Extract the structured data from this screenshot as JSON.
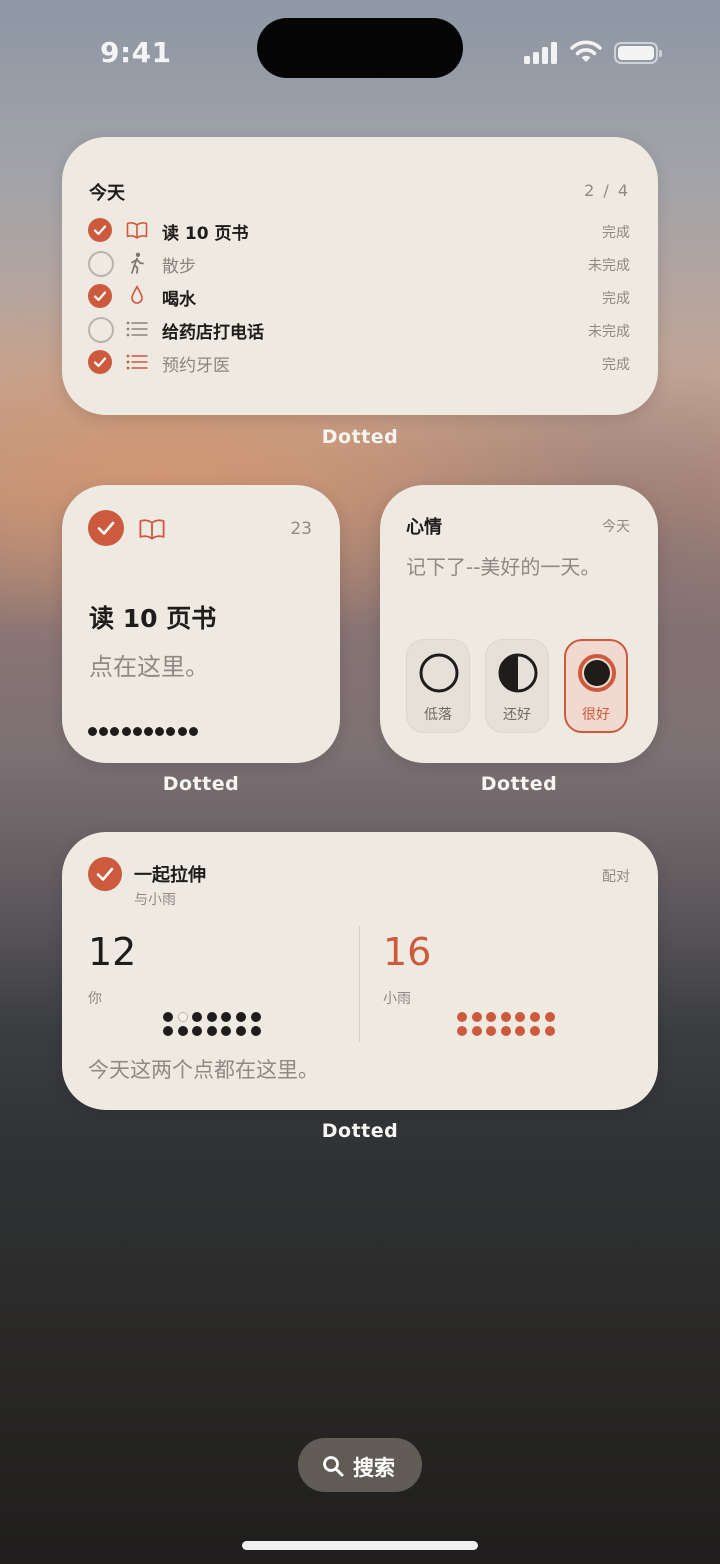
{
  "status_bar": {
    "time": "9:41"
  },
  "tasks_widget": {
    "title": "今天",
    "count": "2 / 4",
    "items": [
      {
        "label": "读 10 页书",
        "status": "完成",
        "done": true,
        "icon": "book-icon"
      },
      {
        "label": "散步",
        "status": "未完成",
        "done": false,
        "icon": "walk-icon"
      },
      {
        "label": "喝水",
        "status": "完成",
        "done": true,
        "icon": "drop-icon"
      },
      {
        "label": "给药店打电话",
        "status": "未完成",
        "done": false,
        "icon": "list-icon"
      },
      {
        "label": "预约牙医",
        "status": "完成",
        "done": true,
        "icon": "list-icon"
      }
    ],
    "caption": "Dotted"
  },
  "reading_widget": {
    "count": "23",
    "title": "读 10 页书",
    "hint": "点在这里。",
    "dots": 10,
    "caption": "Dotted"
  },
  "mood_widget": {
    "title": "心情",
    "date": "今天",
    "prompt": "记下了--美好的一天。",
    "options": [
      {
        "label": "低落",
        "icon": "empty-circle-icon"
      },
      {
        "label": "还好",
        "icon": "half-circle-icon"
      },
      {
        "label": "很好",
        "icon": "filled-circle-icon",
        "selected": true
      }
    ],
    "caption": "Dotted"
  },
  "pair_widget": {
    "title": "一起拉伸",
    "subtitle": "与小雨",
    "mode": "配对",
    "me": {
      "value": "12",
      "name": "你",
      "filled": 13,
      "total": 14
    },
    "partner": {
      "value": "16",
      "name": "小雨",
      "filled": 14,
      "total": 14
    },
    "footer": "今天这两个点都在这里。",
    "caption": "Dotted"
  },
  "search": {
    "label": "搜索",
    "icon": "search-icon"
  },
  "colors": {
    "accent": "#cc5a3c",
    "card": "#eeeae2",
    "ink": "#1f1d1b",
    "muted": "#8f8a84"
  }
}
